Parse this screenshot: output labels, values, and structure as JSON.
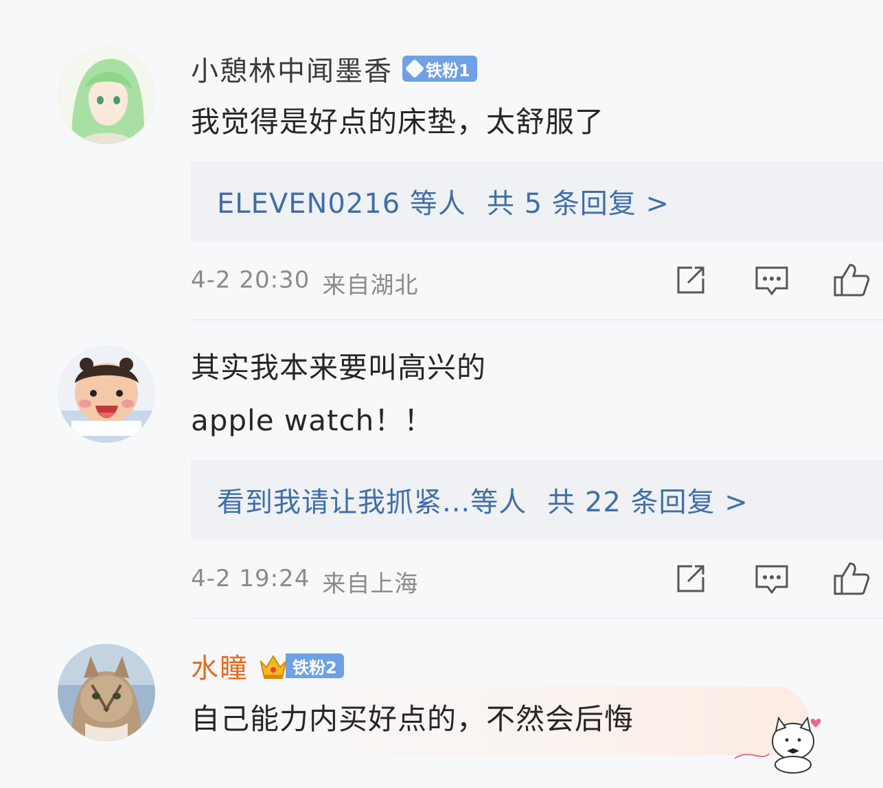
{
  "comments": [
    {
      "username": "小憩林中闻墨香",
      "badge": "铁粉1",
      "text_lines": [
        "我觉得是好点的床垫，太舒服了"
      ],
      "reply_users": "ELEVEN0216 等人",
      "reply_count": "共 5 条回复 >",
      "timestamp": "4-2 20:30",
      "location": "来自湖北"
    },
    {
      "username": "",
      "badge": "",
      "text_lines": [
        "其实我本来要叫高兴的",
        "apple watch！！"
      ],
      "reply_users": "看到我请让我抓紧...等人",
      "reply_count": "共 22 条回复 >",
      "timestamp": "4-2 19:24",
      "location": "来自上海"
    },
    {
      "username": "水瞳",
      "badge": "铁粉2",
      "text_lines": [
        "自己能力内买好点的，不然会后悔"
      ]
    }
  ],
  "icons": {
    "share": "share-icon",
    "comment": "comment-icon",
    "like": "thumbs-up-icon"
  },
  "colors": {
    "reply_link": "#3f6ea8",
    "badge": "#6ea1e6",
    "vip_name": "#e86a1c",
    "meta": "#8a8a8a"
  }
}
